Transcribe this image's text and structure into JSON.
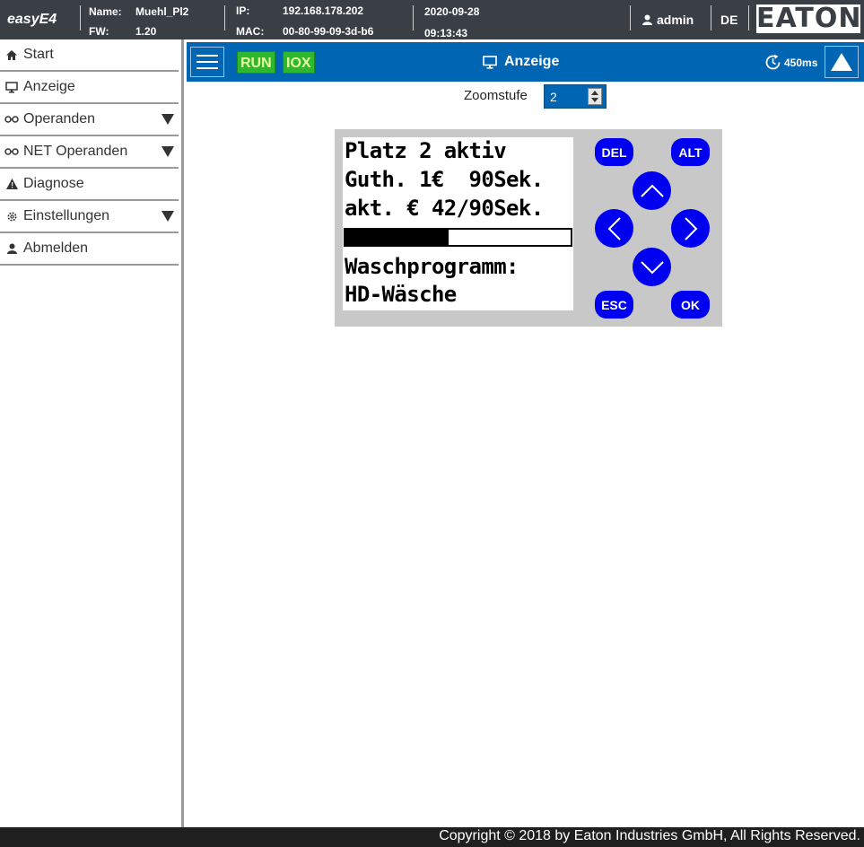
{
  "header": {
    "brand": "easyE4",
    "name_label": "Name:",
    "name_value": "Muehl_Pl2",
    "fw_label": "FW:",
    "fw_value": "1.20",
    "ip_label": "IP:",
    "ip_value": "192.168.178.202",
    "mac_label": "MAC:",
    "mac_value": "00-80-99-09-3d-b6",
    "date": "2020-09-28",
    "time": "09:13:43",
    "user": "admin",
    "language": "DE",
    "logo_text": "EATON"
  },
  "sidebar": {
    "items": [
      {
        "label": "Start",
        "icon": "home-icon",
        "expandable": false
      },
      {
        "label": "Anzeige",
        "icon": "monitor-icon",
        "expandable": false
      },
      {
        "label": "Operanden",
        "icon": "glasses-icon",
        "expandable": true
      },
      {
        "label": "NET Operanden",
        "icon": "glasses-icon",
        "expandable": true
      },
      {
        "label": "Diagnose",
        "icon": "warning-icon",
        "expandable": false
      },
      {
        "label": "Einstellungen",
        "icon": "gear-icon",
        "expandable": true
      },
      {
        "label": "Abmelden",
        "icon": "user-icon",
        "expandable": false
      }
    ]
  },
  "toolbar": {
    "run_label": "RUN",
    "iox_label": "IOX",
    "title": "Anzeige",
    "cycle_time": "450ms"
  },
  "zoom": {
    "label": "Zoomstufe",
    "value": "2"
  },
  "display": {
    "lines": [
      "Platz 2 aktiv",
      "Guth. 1€  90Sek.",
      "akt. € 42/90Sek."
    ],
    "progress": 0.46,
    "lines_bottom": [
      "Waschprogramm:",
      "HD-Wäsche"
    ]
  },
  "keys": {
    "del": "DEL",
    "alt": "ALT",
    "esc": "ESC",
    "ok": "OK"
  },
  "colors": {
    "header_bg": "#3a3f45",
    "toolbar_bg": "#0066b3",
    "status_green": "#2eb82e",
    "key_blue": "#0000f0"
  },
  "footer": {
    "copyright": "Copyright © 2018 by Eaton Industries GmbH, All Rights Reserved."
  }
}
